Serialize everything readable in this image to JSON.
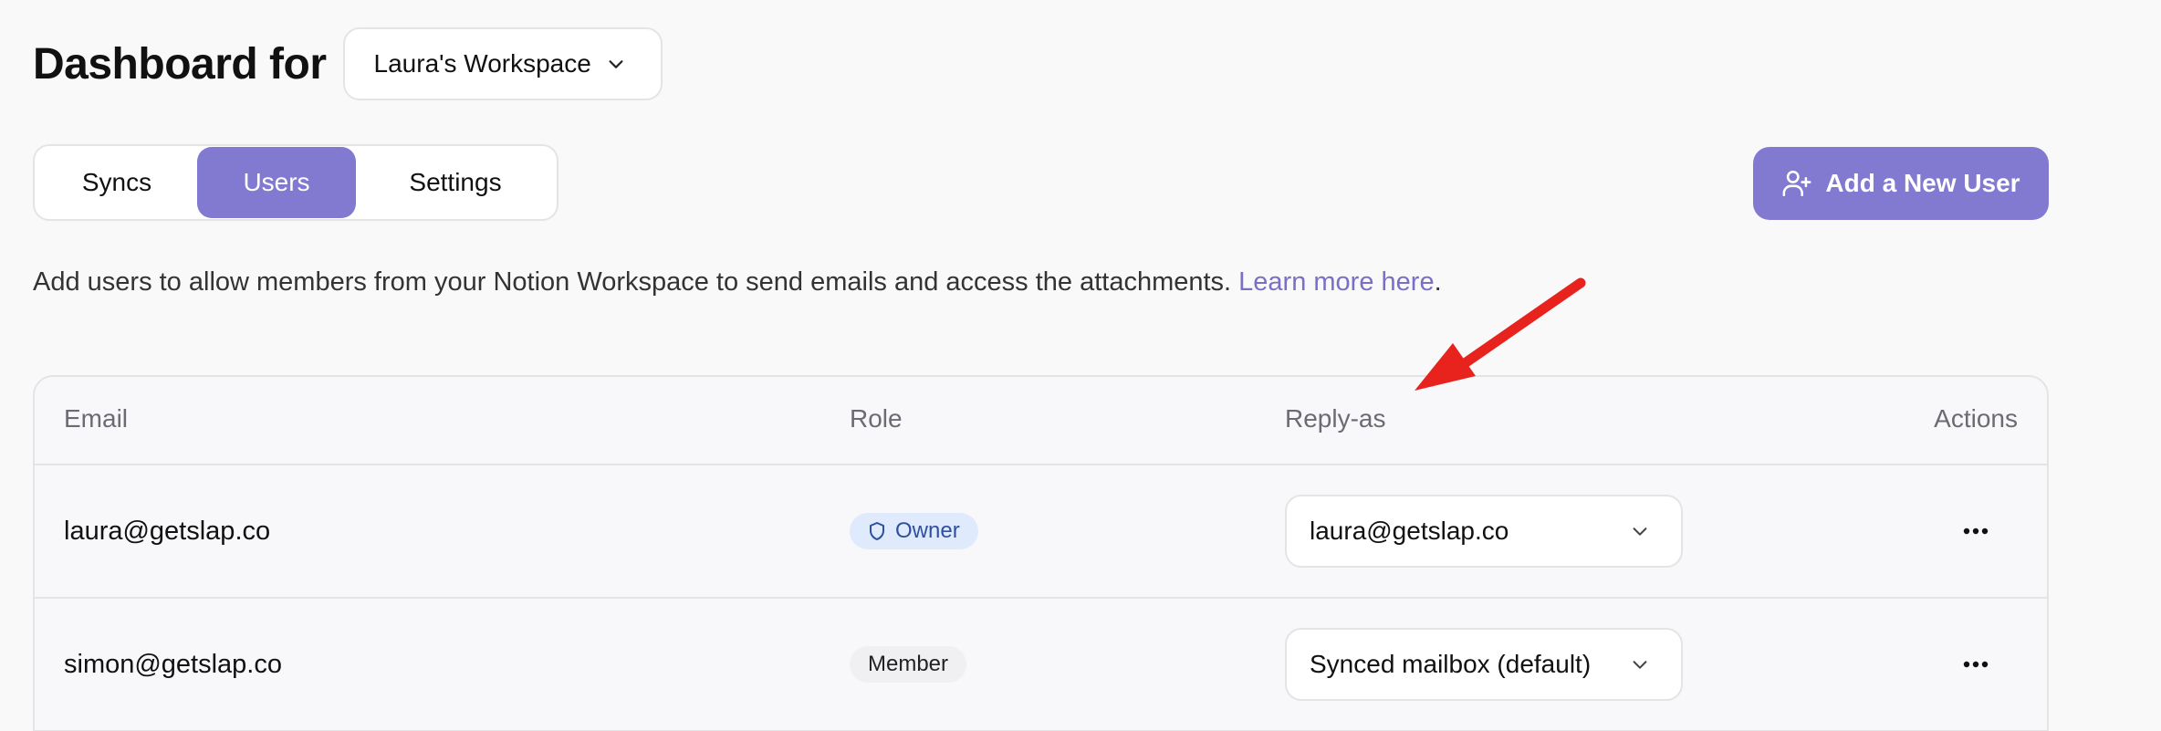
{
  "header": {
    "title": "Dashboard for",
    "workspace_selector": {
      "value": "Laura's Workspace",
      "icon": "chevron-down-icon"
    }
  },
  "tabs": [
    {
      "label": "Syncs",
      "active": false
    },
    {
      "label": "Users",
      "active": true
    },
    {
      "label": "Settings",
      "active": false
    }
  ],
  "add_user_button": {
    "label": "Add a New User",
    "icon": "user-plus-icon"
  },
  "description": {
    "text": "Add users to allow members from your Notion Workspace to send emails and access the attachments. ",
    "link_text": "Learn more here",
    "suffix": "."
  },
  "table": {
    "columns": [
      "Email",
      "Role",
      "Reply-as",
      "Actions"
    ],
    "rows": [
      {
        "email": "laura@getslap.co",
        "role": "Owner",
        "role_icon": "shield-icon",
        "reply_as": "laura@getslap.co"
      },
      {
        "email": "simon@getslap.co",
        "role": "Member",
        "reply_as": "Synced mailbox (default)"
      }
    ]
  },
  "colors": {
    "accent": "#8279d0",
    "link": "#7a6fc8",
    "owner_badge_bg": "#dfeafc",
    "owner_badge_text": "#2f4fa0",
    "annotation_arrow": "#e8231e"
  }
}
